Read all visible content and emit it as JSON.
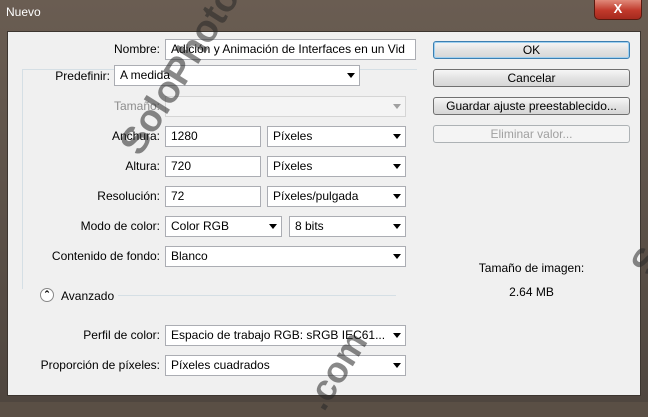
{
  "window": {
    "title": "Nuevo",
    "close_label": "X"
  },
  "form": {
    "name": {
      "label": "Nombre:",
      "value": "Adición y Animación de Interfaces en un Vid"
    },
    "preset": {
      "label": "Predefinir:",
      "value": "A medida"
    },
    "size": {
      "label": "Tamaño:",
      "value": ""
    },
    "width": {
      "label": "Anchura:",
      "value": "1280",
      "unit": "Píxeles"
    },
    "height": {
      "label": "Altura:",
      "value": "720",
      "unit": "Píxeles"
    },
    "resolution": {
      "label": "Resolución:",
      "value": "72",
      "unit": "Píxeles/pulgada"
    },
    "color_mode": {
      "label": "Modo de color:",
      "value": "Color RGB",
      "bits": "8 bits"
    },
    "background": {
      "label": "Contenido de fondo:",
      "value": "Blanco"
    },
    "advanced": {
      "label": "Avanzado",
      "expander_glyph": "⌃"
    },
    "color_profile": {
      "label": "Perfil de color:",
      "value": "Espacio de trabajo RGB: sRGB IEC61..."
    },
    "pixel_ratio": {
      "label": "Proporción de píxeles:",
      "value": "Píxeles cuadrados"
    }
  },
  "buttons": {
    "ok": "OK",
    "cancel": "Cancelar",
    "save_preset": "Guardar ajuste preestablecido...",
    "delete_preset": "Eliminar valor..."
  },
  "image_size": {
    "label": "Tamaño de imagen:",
    "value": "2.64 MB"
  },
  "watermark": {
    "text1": "SoloPhotoshop.com",
    "text2": ".com",
    "text3": "S"
  }
}
